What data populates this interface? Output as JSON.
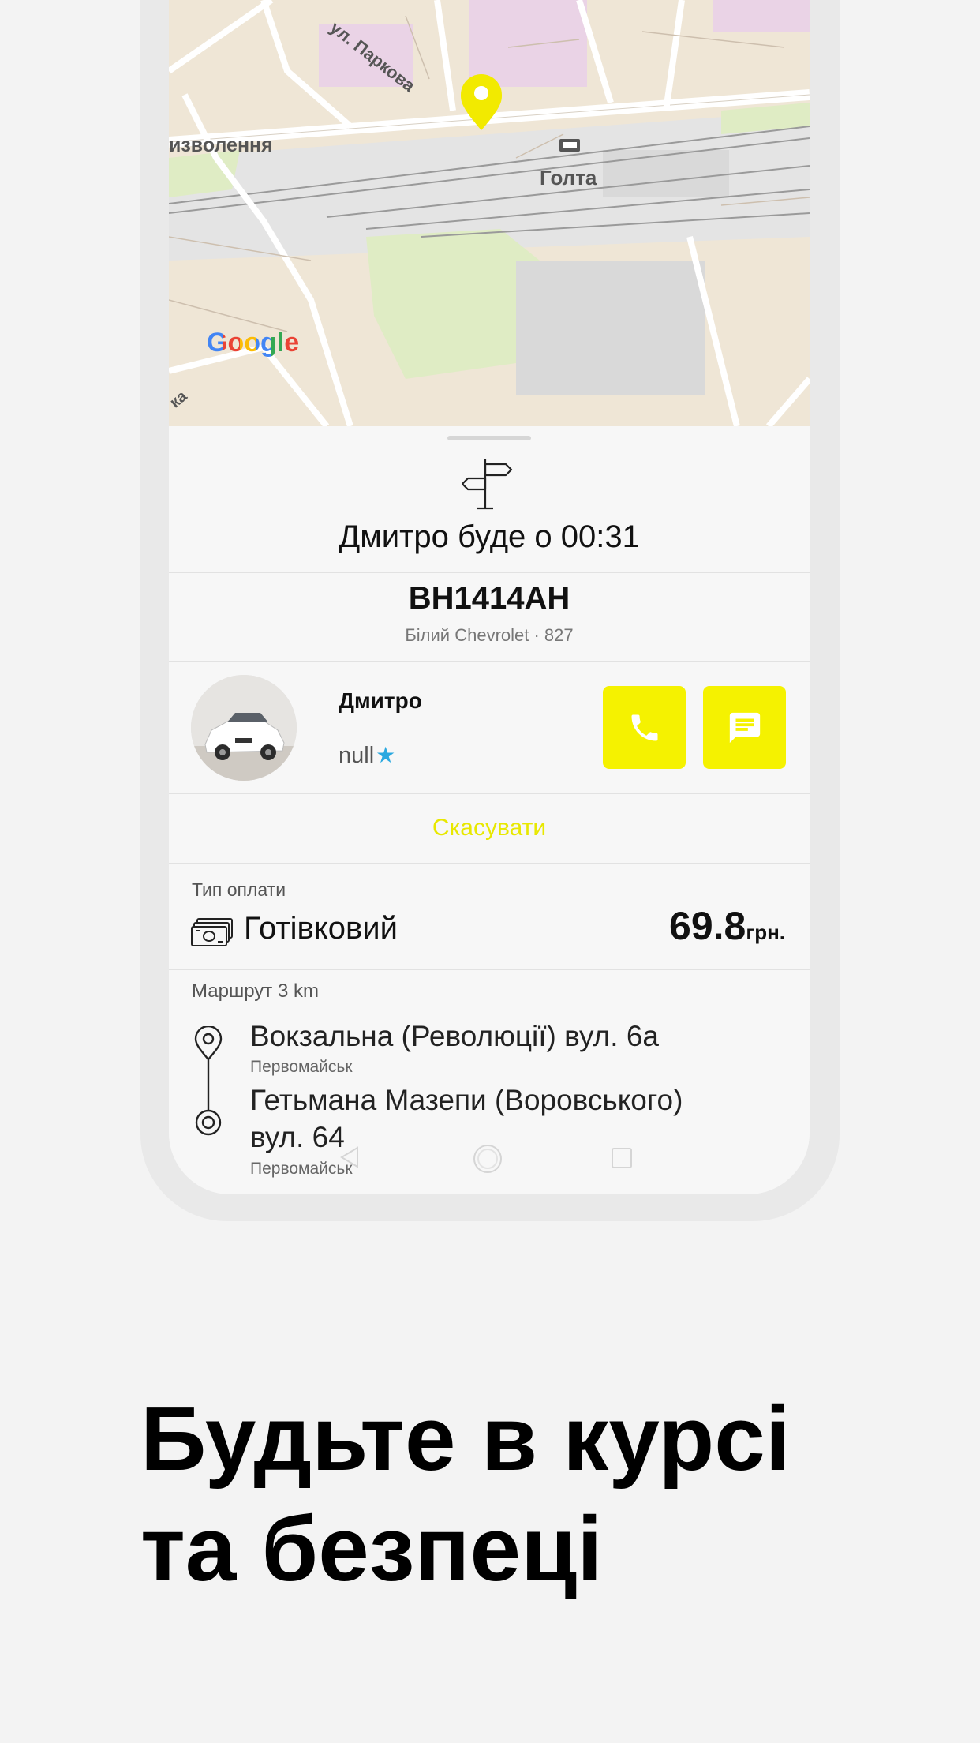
{
  "map": {
    "street_label_1": "ул. Паркова",
    "street_label_2": "изволення",
    "station_label": "Голта",
    "corner_label": "ка",
    "google_logo": "Google",
    "pin_color": "#f2ea00"
  },
  "trip": {
    "eta_text": "Дмитро буде о 00:31",
    "plate": "BH1414AH",
    "car_description": "Білий Chevrolet · 827"
  },
  "driver": {
    "name": "Дмитро",
    "rating": "null",
    "star": "★"
  },
  "actions": {
    "call_icon": "phone-icon",
    "message_icon": "message-icon",
    "cancel_label": "Скасувати",
    "accent_color": "#f5f200"
  },
  "payment": {
    "label": "Тип оплати",
    "type": "Готівковий",
    "amount": "69.8",
    "currency": "грн."
  },
  "route": {
    "label": "Маршрут 3 km",
    "from_address": "Вокзальна (Революції) вул. 6а",
    "from_city": "Первомайськ",
    "to_address_line1": "Гетьмана Мазепи (Воровського)",
    "to_address_line2": "вул. 64",
    "to_city": "Первомайськ"
  },
  "headline": {
    "line1": "Будьте в курсі",
    "line2": "та безпеці"
  }
}
